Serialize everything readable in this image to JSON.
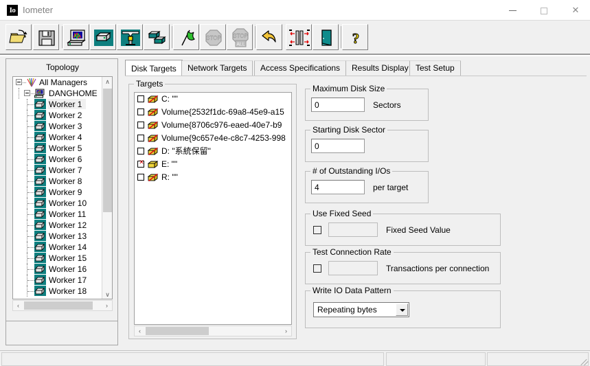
{
  "window": {
    "title": "Iometer",
    "logo_text": "Io",
    "minimize_label": "Minimize",
    "maximize_label": "Maximize",
    "close_label": "Close"
  },
  "toolbar": {
    "buttons": [
      {
        "name": "open-config-button",
        "icon": "open-folder-icon",
        "tooltip": "Open Test Configuration File"
      },
      {
        "name": "save-config-button",
        "icon": "floppy-save-icon",
        "tooltip": "Save Test Configuration File"
      },
      {
        "name": "new-manager-button",
        "icon": "computer-monitor-icon",
        "tooltip": "Add New Manager"
      },
      {
        "name": "new-worker-button",
        "icon": "worker-disk-icon",
        "tooltip": "Add New Worker"
      },
      {
        "name": "disconnect-button",
        "icon": "disconnect-fork-icon",
        "tooltip": "Disconnect Selected Manager or Worker"
      },
      {
        "name": "duplicate-worker-button",
        "icon": "duplicate-disk-icon",
        "tooltip": "Duplicate Selected Worker"
      },
      {
        "name": "start-tests-button",
        "icon": "green-flag-icon",
        "tooltip": "Start Tests"
      },
      {
        "name": "stop-test-button",
        "icon": "stop-sign-icon",
        "tooltip": "Stop Current Test"
      },
      {
        "name": "stop-all-tests-button",
        "icon": "stop-all-sign-icon",
        "tooltip": "Stop All Tests"
      },
      {
        "name": "reset-button",
        "icon": "yellow-undo-arrow-icon",
        "tooltip": "Reset Workers and Configuration"
      },
      {
        "name": "swap-button",
        "icon": "red-arrows-swap-icon",
        "tooltip": "Swap"
      },
      {
        "name": "exit-button",
        "icon": "exit-door-icon",
        "tooltip": "Exit"
      },
      {
        "name": "help-button",
        "icon": "question-mark-icon",
        "tooltip": "Help"
      }
    ],
    "stop_label": "STOP",
    "stop_all_label": "ALL",
    "help_glyph": "?"
  },
  "topology": {
    "title": "Topology",
    "root": {
      "label": "All Managers",
      "icon": "all-managers-icon",
      "expanded": true
    },
    "host": {
      "label": "DANGHOME",
      "icon": "computer-host-icon",
      "expanded": true
    },
    "workers": [
      {
        "label": "Worker 1",
        "selected": true
      },
      {
        "label": "Worker 2",
        "selected": false
      },
      {
        "label": "Worker 3",
        "selected": false
      },
      {
        "label": "Worker 4",
        "selected": false
      },
      {
        "label": "Worker 5",
        "selected": false
      },
      {
        "label": "Worker 6",
        "selected": false
      },
      {
        "label": "Worker 7",
        "selected": false
      },
      {
        "label": "Worker 8",
        "selected": false
      },
      {
        "label": "Worker 9",
        "selected": false
      },
      {
        "label": "Worker 10",
        "selected": false
      },
      {
        "label": "Worker 11",
        "selected": false
      },
      {
        "label": "Worker 12",
        "selected": false
      },
      {
        "label": "Worker 13",
        "selected": false
      },
      {
        "label": "Worker 14",
        "selected": false
      },
      {
        "label": "Worker 15",
        "selected": false
      },
      {
        "label": "Worker 16",
        "selected": false
      },
      {
        "label": "Worker 17",
        "selected": false
      },
      {
        "label": "Worker 18",
        "selected": false
      }
    ],
    "scroll_up_glyph": "∧",
    "scroll_down_glyph": "∨",
    "scroll_left_glyph": "‹",
    "scroll_right_glyph": "›"
  },
  "tabs": [
    {
      "label": "Disk Targets",
      "active": true
    },
    {
      "label": "Network Targets",
      "active": false
    },
    {
      "label": "Access Specifications",
      "active": false
    },
    {
      "label": "Results Display",
      "active": false
    },
    {
      "label": "Test Setup",
      "active": false
    }
  ],
  "targets": {
    "group_label": "Targets",
    "items": [
      {
        "label": "C: \"\"",
        "checked": false,
        "icon": "disk-disabled-icon"
      },
      {
        "label": "Volume{2532f1dc-69a8-45e9-a15",
        "checked": false,
        "icon": "disk-disabled-icon"
      },
      {
        "label": "Volume{8706c976-eaed-40e7-b9",
        "checked": false,
        "icon": "disk-disabled-icon"
      },
      {
        "label": "Volume{9c657e4e-c8c7-4253-998",
        "checked": false,
        "icon": "disk-disabled-icon"
      },
      {
        "label": "D: \"系統保留\"",
        "checked": false,
        "icon": "disk-disabled-icon"
      },
      {
        "label": "E: \"\"",
        "checked": true,
        "icon": "disk-enabled-icon"
      },
      {
        "label": "R: \"\"",
        "checked": false,
        "icon": "disk-disabled-icon"
      }
    ],
    "scroll_left_glyph": "‹",
    "scroll_right_glyph": "›"
  },
  "settings": {
    "max_disk_size": {
      "label": "Maximum Disk Size",
      "value": "0",
      "unit": "Sectors"
    },
    "starting_disk_sector": {
      "label": "Starting Disk Sector",
      "value": "0",
      "unit": ""
    },
    "outstanding_ios": {
      "label": "# of Outstanding I/Os",
      "value": "4",
      "unit": "per target"
    },
    "use_fixed_seed": {
      "label": "Use Fixed Seed",
      "checked": false,
      "value": "",
      "unit": "Fixed Seed Value"
    },
    "test_connection_rate": {
      "label": "Test Connection Rate",
      "checked": false,
      "value": "",
      "unit": "Transactions per connection"
    },
    "write_io_data_pattern": {
      "label": "Write IO Data Pattern",
      "selected": "Repeating bytes"
    }
  },
  "statusbar": {
    "pane1": "",
    "pane2": "",
    "pane3": ""
  }
}
